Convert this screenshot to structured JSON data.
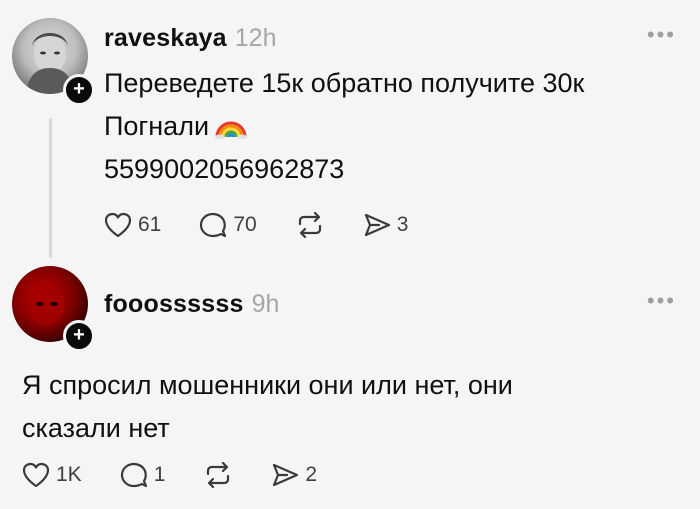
{
  "posts": [
    {
      "username": "raveskaya",
      "time": "12h",
      "more": "•••",
      "lines": [
        "Переведете 15к обратно получите 30к",
        "Погнали",
        "5599002056962873"
      ],
      "emoji": "rainbow-icon",
      "likes": "61",
      "comments": "70",
      "shares": "3"
    },
    {
      "username": "fooossssss",
      "time": "9h",
      "more": "•••",
      "lines": [
        "Я спросил мошенники они или нет, они",
        "сказали нет"
      ],
      "likes": "1K",
      "comments": "1",
      "shares": "2"
    }
  ],
  "follow_glyph": "+",
  "colors": {
    "background": "#f5f5f5",
    "text": "#101010",
    "muted": "#a6a6a6"
  }
}
